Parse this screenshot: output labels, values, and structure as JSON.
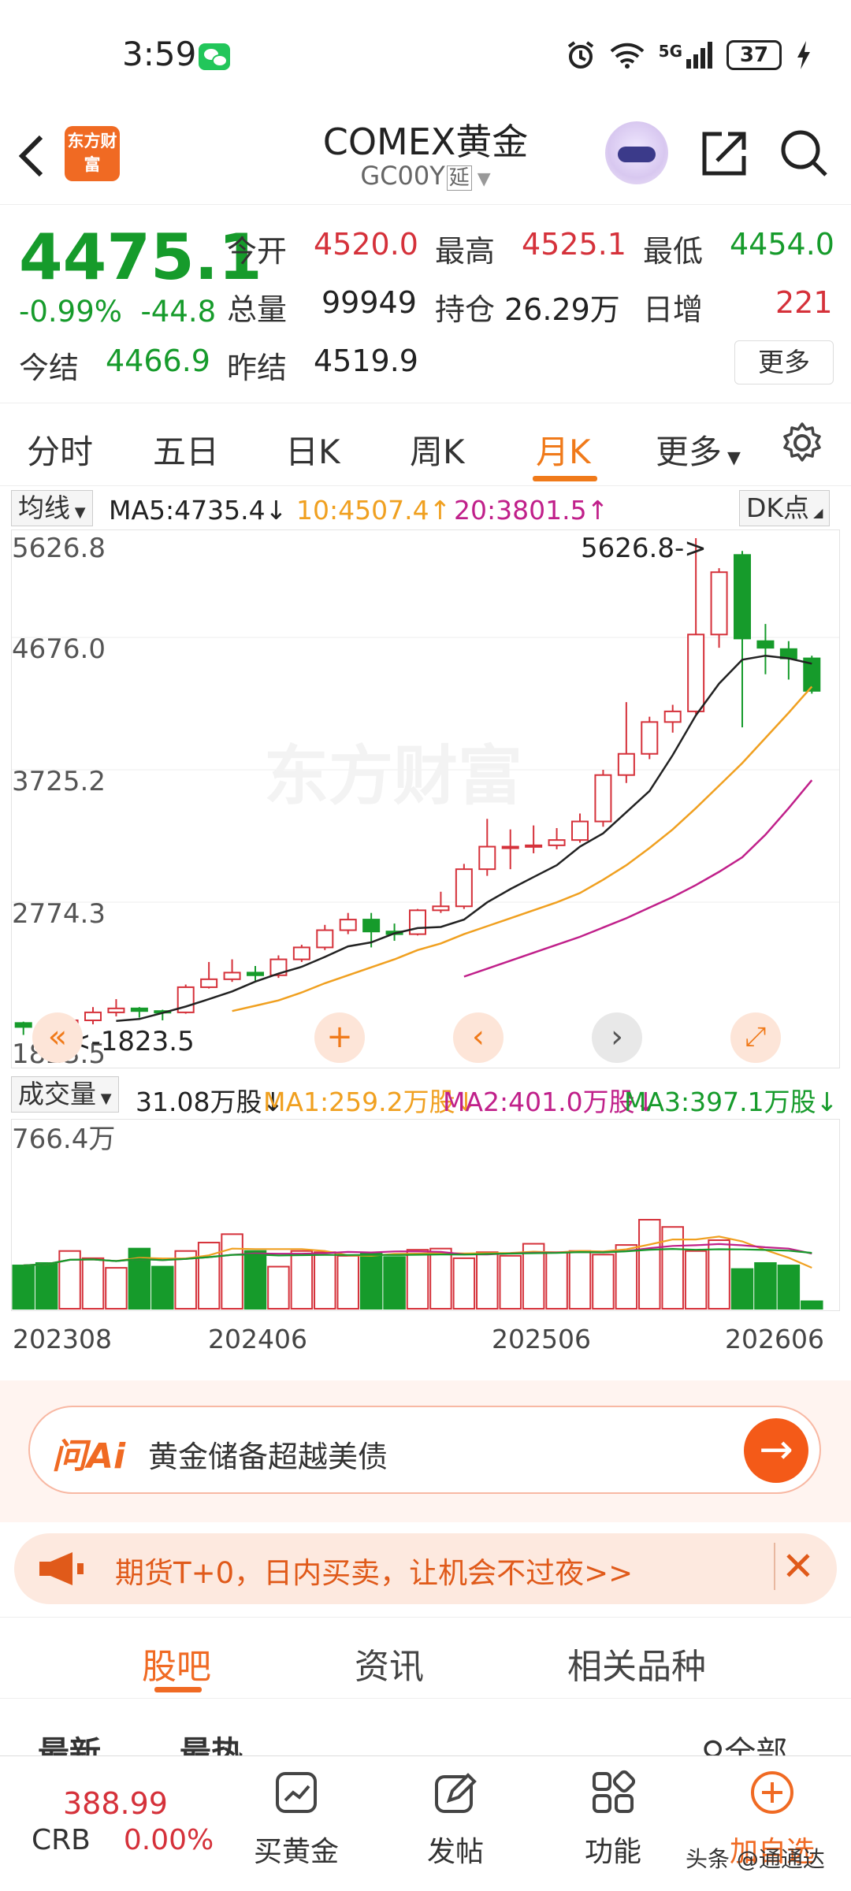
{
  "status": {
    "time": "3:59",
    "battery": "37",
    "network": "5G"
  },
  "header": {
    "title": "COMEX黄金",
    "code": "GC00Y",
    "delay_tag": "延",
    "brand": "东方财富"
  },
  "quote": {
    "price": "4475.1",
    "change_pct": "-0.99%",
    "change": "-44.8",
    "open_label": "今开",
    "open": "4520.0",
    "high_label": "最高",
    "high": "4525.1",
    "low_label": "最低",
    "low": "4454.0",
    "vol_label": "总量",
    "vol": "99949",
    "oi_label": "持仓",
    "oi": "26.29万",
    "daily_inc_label": "日增",
    "daily_inc": "221",
    "settle_label": "今结",
    "settle": "4466.9",
    "prev_settle_label": "昨结",
    "prev_settle": "4519.9",
    "more_label": "更多"
  },
  "tabs": [
    {
      "label": "分时"
    },
    {
      "label": "五日"
    },
    {
      "label": "日K"
    },
    {
      "label": "周K"
    },
    {
      "label": "月K"
    },
    {
      "label": "更多"
    }
  ],
  "ma": {
    "selector": "均线",
    "ma5": "MA5:4735.4↓",
    "ma10": "10:4507.4↑",
    "ma20": "20:3801.5↑",
    "dk_label": "DK点"
  },
  "chart_axes": {
    "y_top": "5626.8",
    "y2": "4676.0",
    "y3": "3725.2",
    "y4": "2774.3",
    "y_bottom": "1823.5",
    "max_annot": "5626.8->",
    "min_annot": "<-1823.5",
    "watermark": "东方财富"
  },
  "volume": {
    "selector": "成交量",
    "vol": "31.08万股↓",
    "ma1": "MA1:259.2万股↓",
    "ma2": "MA2:401.0万股↓",
    "ma3": "MA3:397.1万股↓",
    "max_label": "766.4万"
  },
  "x_dates": [
    "202308",
    "202406",
    "202506",
    "202606"
  ],
  "colors": {
    "up": "#d5313a",
    "down": "#169b2b",
    "ma5": "#222222",
    "ma10": "#f0a020",
    "ma20": "#c0208a",
    "accent": "#f06a23"
  },
  "chart_data": {
    "type": "candlestick",
    "x": [
      "202308",
      "202309",
      "202310",
      "202311",
      "202312",
      "202401",
      "202402",
      "202403",
      "202404",
      "202405",
      "202406",
      "202407",
      "202408",
      "202409",
      "202410",
      "202411",
      "202412",
      "202501",
      "202502",
      "202503",
      "202504",
      "202505",
      "202506",
      "202507",
      "202508",
      "202509",
      "202510",
      "202511",
      "202512",
      "202601",
      "202602",
      "202603",
      "202604",
      "202605",
      "202606"
    ],
    "ohlc": [
      [
        1970,
        1980,
        1880,
        1940
      ],
      [
        1940,
        1955,
        1845,
        1870
      ],
      [
        1870,
        2000,
        1823.5,
        1990
      ],
      [
        1990,
        2090,
        1960,
        2050
      ],
      [
        2050,
        2150,
        2020,
        2080
      ],
      [
        2080,
        2090,
        2010,
        2060
      ],
      [
        2060,
        2070,
        1990,
        2050
      ],
      [
        2050,
        2260,
        2040,
        2240
      ],
      [
        2240,
        2430,
        2230,
        2300
      ],
      [
        2300,
        2450,
        2280,
        2350
      ],
      [
        2350,
        2400,
        2290,
        2330
      ],
      [
        2330,
        2480,
        2310,
        2450
      ],
      [
        2450,
        2560,
        2430,
        2540
      ],
      [
        2540,
        2710,
        2520,
        2670
      ],
      [
        2670,
        2800,
        2640,
        2750
      ],
      [
        2750,
        2800,
        2540,
        2660
      ],
      [
        2660,
        2720,
        2590,
        2640
      ],
      [
        2640,
        2830,
        2630,
        2820
      ],
      [
        2820,
        2960,
        2800,
        2850
      ],
      [
        2850,
        3170,
        2830,
        3130
      ],
      [
        3130,
        3510,
        3080,
        3300
      ],
      [
        3300,
        3430,
        3130,
        3300
      ],
      [
        3300,
        3460,
        3250,
        3310
      ],
      [
        3310,
        3440,
        3280,
        3350
      ],
      [
        3350,
        3550,
        3330,
        3490
      ],
      [
        3490,
        3880,
        3450,
        3840
      ],
      [
        3840,
        4390,
        3780,
        4000
      ],
      [
        4000,
        4280,
        3960,
        4240
      ],
      [
        4240,
        4370,
        4160,
        4320
      ],
      [
        4320,
        5626.8,
        4300,
        4900
      ],
      [
        4900,
        5400,
        4800,
        5370
      ],
      [
        5500,
        5530,
        4200,
        4870
      ],
      [
        4850,
        4980,
        4600,
        4800
      ],
      [
        4790,
        4850,
        4560,
        4720
      ],
      [
        4720,
        4740,
        4454,
        4475.1
      ]
    ],
    "ma5": [
      null,
      null,
      null,
      null,
      1986,
      2000,
      2046,
      2094,
      2150,
      2208,
      2282,
      2342,
      2394,
      2468,
      2548,
      2578,
      2646,
      2686,
      2694,
      2750,
      2880,
      2980,
      3070,
      3160,
      3300,
      3400,
      3560,
      3720,
      3990,
      4290,
      4530,
      4710,
      4740,
      4720,
      4680
    ],
    "ma10": [
      null,
      null,
      null,
      null,
      null,
      null,
      null,
      null,
      null,
      2060,
      2100,
      2140,
      2200,
      2270,
      2330,
      2390,
      2450,
      2520,
      2570,
      2640,
      2700,
      2760,
      2820,
      2880,
      2950,
      3050,
      3160,
      3290,
      3430,
      3590,
      3760,
      3930,
      4120,
      4310,
      4507.4
    ],
    "ma20": [
      null,
      null,
      null,
      null,
      null,
      null,
      null,
      null,
      null,
      null,
      null,
      null,
      null,
      null,
      null,
      null,
      null,
      null,
      null,
      2320,
      2380,
      2440,
      2500,
      2560,
      2620,
      2690,
      2760,
      2840,
      2920,
      3010,
      3110,
      3220,
      3390,
      3590,
      3801.5
    ],
    "volume": [
      180,
      190,
      240,
      210,
      170,
      250,
      175,
      240,
      275,
      310,
      240,
      175,
      240,
      235,
      220,
      230,
      215,
      245,
      250,
      210,
      235,
      220,
      270,
      235,
      240,
      225,
      265,
      370,
      340,
      240,
      285,
      165,
      190,
      180,
      31.08
    ],
    "volume_ylim": [
      0,
      766.4
    ],
    "ylim": [
      1823.5,
      5626.8
    ]
  },
  "ai": {
    "logo": "问Ai",
    "text": "黄金储备超越美债"
  },
  "banner": {
    "text": "期货T+0，日内买卖，让机会不过夜>>"
  },
  "subtabs": [
    {
      "label": "股吧"
    },
    {
      "label": "资讯"
    },
    {
      "label": "相关品种"
    }
  ],
  "feed_peek": {
    "newest": "最新",
    "hottest": "最热",
    "all": "全部"
  },
  "bottom": {
    "crb_value": "388.99",
    "crb_label": "CRB",
    "crb_change": "0.00%",
    "buy": "买黄金",
    "post": "发帖",
    "func": "功能",
    "add": "加自选"
  },
  "watermark": "头条 @通通达"
}
